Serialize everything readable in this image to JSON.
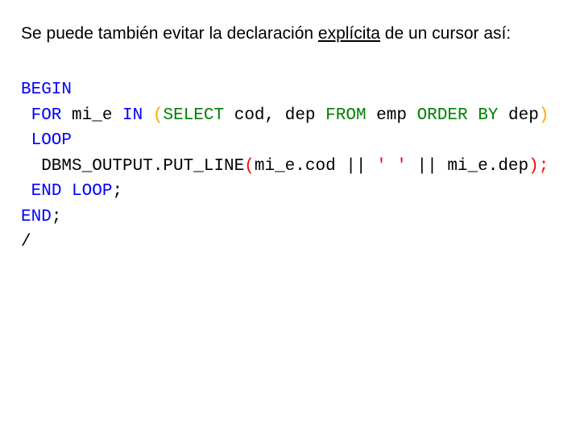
{
  "intro": {
    "part1": "Se puede también evitar la declaración ",
    "underlined": "explícita",
    "part2": " de un cursor así:"
  },
  "code": {
    "t_begin": "BEGIN",
    "t_for": " FOR",
    "t_mi_e": " mi_e ",
    "t_in": "IN",
    "t_sp1": " ",
    "t_lpar1": "(",
    "t_select": "SELECT",
    "t_cols": " cod, dep ",
    "t_from": "FROM",
    "t_emp": " emp ",
    "t_order": "ORDER BY",
    "t_dep": " dep",
    "t_rpar1": ")",
    "t_loop": " LOOP",
    "t_dbms_pre": "  DBMS_OUTPUT.PUT_LINE",
    "t_lpar2": "(",
    "t_expr1": "mi_e.cod || ",
    "t_str": "' '",
    "t_expr2": " || mi_e.dep",
    "t_rpar2_semi": ");",
    "t_endloop_pre": " ",
    "t_endloop_kw": "END LOOP",
    "t_endloop_semi": ";",
    "t_end_kw": "END",
    "t_end_semi": ";",
    "t_slash": "/"
  }
}
